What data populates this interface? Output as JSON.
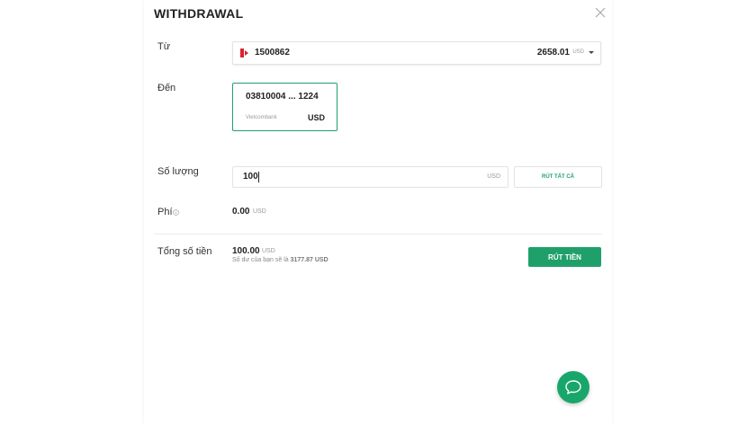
{
  "title": "WITHDRAWAL",
  "labels": {
    "from": "Từ",
    "to": "Đến",
    "amount": "Số lượng",
    "fee": "Phí",
    "total": "Tổng số tiền"
  },
  "from_account": {
    "number": "1500862",
    "balance": "2658.01",
    "currency": "USD"
  },
  "destination": {
    "number": "03810004 ... 1224",
    "bank": "Vietcombank",
    "currency": "USD"
  },
  "amount_input": {
    "value": "100",
    "currency": "USD"
  },
  "withdraw_all_label": "RÚT TẤT CẢ",
  "fee": {
    "value": "0.00",
    "currency": "USD"
  },
  "total": {
    "value": "100.00",
    "currency": "USD",
    "balance_note_prefix": "Số dư của bạn sẽ là",
    "balance_after": "3177.87 USD"
  },
  "submit_label": "RÚT TIỀN",
  "icons": {
    "close": "close-icon",
    "flag": "flag-icon",
    "info": "info-icon",
    "chat": "chat-icon"
  },
  "colors": {
    "accent": "#1fa06a",
    "chat": "#19a66a"
  }
}
